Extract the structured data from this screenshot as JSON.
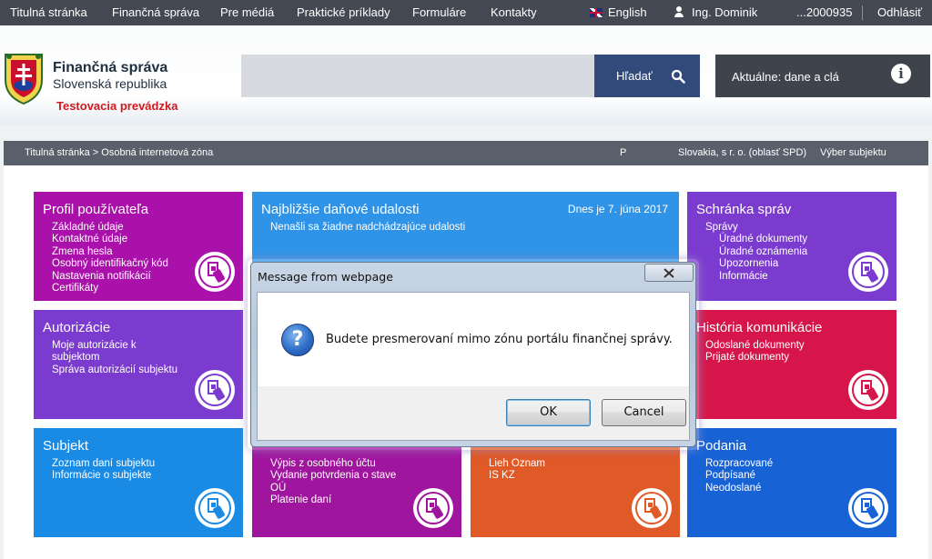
{
  "topnav": {
    "items": [
      "Titulná stránka",
      "Finančná správa",
      "Pre médiá",
      "Praktické príklady",
      "Formuláre",
      "Kontakty"
    ],
    "language": "English",
    "user": "Ing. Dominik",
    "account": "...2000935",
    "logout": "Odhlásiť"
  },
  "header": {
    "org_line1": "Finančná správa",
    "org_line2": "Slovenská republika",
    "test_mode": "Testovacia prevádzka",
    "search_placeholder": "",
    "search_button": "Hľadať",
    "news_label": "Aktuálne: dane a clá"
  },
  "breadcrumb": {
    "path": "Titulná stránka > Osobná internetová zóna",
    "flag": "P",
    "subject": "Slovakia, s r. o. (oblasť SPD)",
    "select_subject": "Výber subjektu"
  },
  "tiles": {
    "profile": {
      "title": "Profil používateľa",
      "links": [
        "Základné údaje",
        "Kontaktné údaje",
        "Zmena hesla",
        "Osobný identifikačný kód",
        "Nastavenia notifikácií",
        "Certifikáty"
      ]
    },
    "events": {
      "title": "Najbližšie daňové udalosti",
      "date": "Dnes je 7. júna 2017",
      "links": [
        "Nenašli sa žiadne nadchádzajúce udalosti"
      ]
    },
    "inbox": {
      "title": "Schránka správ",
      "links": [
        "Správy",
        "Úradné dokumenty",
        "Úradné oznámenia",
        "Upozornenia",
        "Informácie"
      ]
    },
    "authorizations": {
      "title": "Autorizácie",
      "links": [
        "Moje autorizácie k",
        "subjektom",
        "Správa autorizácií subjektu"
      ]
    },
    "history": {
      "title": "História komunikácie",
      "links": [
        "Odoslané dokumenty",
        "Prijaté dokumenty"
      ]
    },
    "subject": {
      "title": "Subjekt",
      "links": [
        "Zoznam daní subjektu",
        "Informácie o subjekte"
      ]
    },
    "account": {
      "links": [
        "Výpis z osobného účtu",
        "Vydanie potvrdenia o stave",
        "OÚ",
        "Platenie daní"
      ]
    },
    "registries": {
      "links": [
        "Lieh Oznam",
        "IS KZ"
      ]
    },
    "submissions": {
      "title": "Podania",
      "links": [
        "Rozpracované",
        "Podpísané",
        "Neodoslané"
      ]
    }
  },
  "dialog": {
    "title": "Message from webpage",
    "message": "Budete presmerovaní mimo zónu portálu finančnej správy.",
    "ok": "OK",
    "cancel": "Cancel"
  },
  "icons": [
    "user-icon",
    "search-icon",
    "info-icon",
    "document-icon",
    "question-icon",
    "close-icon",
    "crest-logo"
  ],
  "colors": {
    "topnav": "#434852",
    "search_button": "#314a7a",
    "profile_tile": "#aa10aa",
    "events_tile": "#2f94e8",
    "authorizations_tile": "#7c3bcf",
    "history_tile": "#d6164a",
    "subject_tile": "#1a8be4",
    "account_tile": "#a0159e",
    "registries_tile": "#e05a28",
    "submissions_tile": "#1763d6",
    "test_mode": "#d0191e"
  }
}
